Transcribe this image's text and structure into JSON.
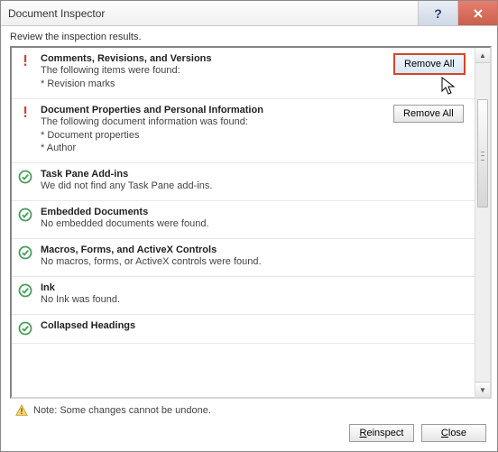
{
  "title": "Document Inspector",
  "subtitle": "Review the inspection results.",
  "remove_all_label": "Remove All",
  "sections": [
    {
      "icon": "warn",
      "title": "Comments, Revisions, and Versions",
      "lines": [
        "The following items were found:",
        "* Revision marks"
      ],
      "action": true,
      "highlight": true
    },
    {
      "icon": "warn",
      "title": "Document Properties and Personal Information",
      "lines": [
        "The following document information was found:",
        "* Document properties",
        "* Author"
      ],
      "action": true,
      "highlight": false
    },
    {
      "icon": "ok",
      "title": "Task Pane Add-ins",
      "lines": [
        "We did not find any Task Pane add-ins."
      ],
      "action": false
    },
    {
      "icon": "ok",
      "title": "Embedded Documents",
      "lines": [
        "No embedded documents were found."
      ],
      "action": false
    },
    {
      "icon": "ok",
      "title": "Macros, Forms, and ActiveX Controls",
      "lines": [
        "No macros, forms, or ActiveX controls were found."
      ],
      "action": false
    },
    {
      "icon": "ok",
      "title": "Ink",
      "lines": [
        "No Ink was found."
      ],
      "action": false
    },
    {
      "icon": "ok",
      "title": "Collapsed Headings",
      "lines": [],
      "action": false
    }
  ],
  "note": "Note: Some changes cannot be undone.",
  "footer": {
    "reinspect": "Reinspect",
    "close": "Close"
  },
  "icons": {
    "warn_color": "#c0504d",
    "ok_color": "#4a9e5c",
    "alert_color": "#f0b83b"
  }
}
